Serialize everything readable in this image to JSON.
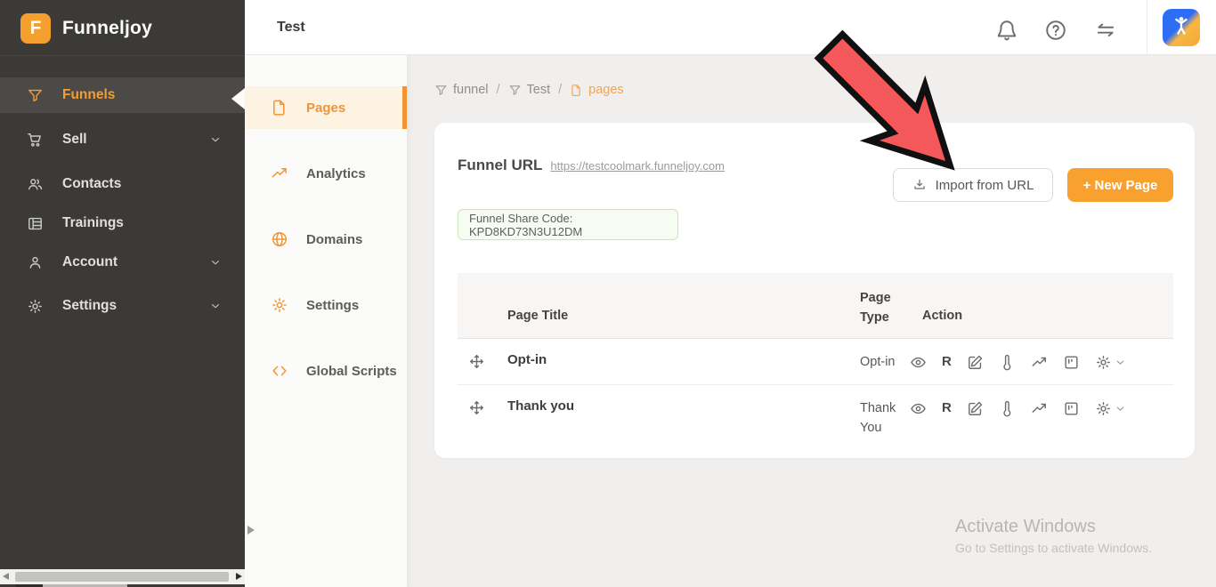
{
  "app": {
    "name": "Funneljoy",
    "logo_letter": "F"
  },
  "topbar": {
    "title": "Test",
    "icons": [
      "bell-icon",
      "help-icon",
      "swap-arrows-icon",
      "app-avatar"
    ]
  },
  "sidebar": {
    "items": [
      {
        "label": "Funnels",
        "icon": "funnel-icon",
        "active": true,
        "chevron": false
      },
      {
        "label": "Sell",
        "icon": "cart-icon",
        "active": false,
        "chevron": true
      },
      {
        "label": "Contacts",
        "icon": "contacts-icon",
        "active": false,
        "chevron": false
      },
      {
        "label": "Trainings",
        "icon": "trainings-icon",
        "active": false,
        "chevron": false
      },
      {
        "label": "Account",
        "icon": "account-icon",
        "active": false,
        "chevron": true
      },
      {
        "label": "Settings",
        "icon": "gear-icon",
        "active": false,
        "chevron": true
      }
    ]
  },
  "subsidebar": {
    "items": [
      {
        "label": "Pages",
        "icon": "page-icon",
        "active": true
      },
      {
        "label": "Analytics",
        "icon": "trend-icon",
        "active": false
      },
      {
        "label": "Domains",
        "icon": "globe-icon",
        "active": false
      },
      {
        "label": "Settings",
        "icon": "gear-icon",
        "active": false
      },
      {
        "label": "Global Scripts",
        "icon": "code-icon",
        "active": false
      }
    ]
  },
  "breadcrumb": {
    "separator": "/",
    "items": [
      {
        "label": "funnel",
        "icon": "funnel-icon",
        "active": false
      },
      {
        "label": "Test",
        "icon": "funnel-icon",
        "active": false
      },
      {
        "label": "pages",
        "icon": "page-icon",
        "active": true
      }
    ]
  },
  "main": {
    "funnel_url_label": "Funnel URL",
    "funnel_url": "https://testcoolmark.funneljoy.com",
    "share_code": "Funnel Share Code: KPD8KD73N3U12DM",
    "import_button": "Import from URL",
    "new_page_button": "+ New Page",
    "table": {
      "headers": [
        "Page Title",
        "Page Type",
        "Action"
      ],
      "r_label": "R",
      "action_icons": [
        "eye-icon",
        "r-badge",
        "edit-icon",
        "thermometer-icon",
        "stats-icon",
        "kanban-icon",
        "gear-icon",
        "chevron-down-icon"
      ],
      "rows": [
        {
          "title": "Opt-in",
          "type": "Opt-in"
        },
        {
          "title": "Thank you",
          "type": "Thank You"
        }
      ]
    }
  },
  "watermark": {
    "line1": "Activate Windows",
    "line2": "Go to Settings to activate Windows."
  },
  "colors": {
    "accent_orange": "#f29d35",
    "button_orange": "#f8a12f",
    "sidebar_bg": "#3b3a37",
    "active_item_bg": "#4c4a47",
    "share_green_bg": "#f6fcf1",
    "share_green_border": "#c8e7b8",
    "arrow_red": "#f4585b"
  }
}
